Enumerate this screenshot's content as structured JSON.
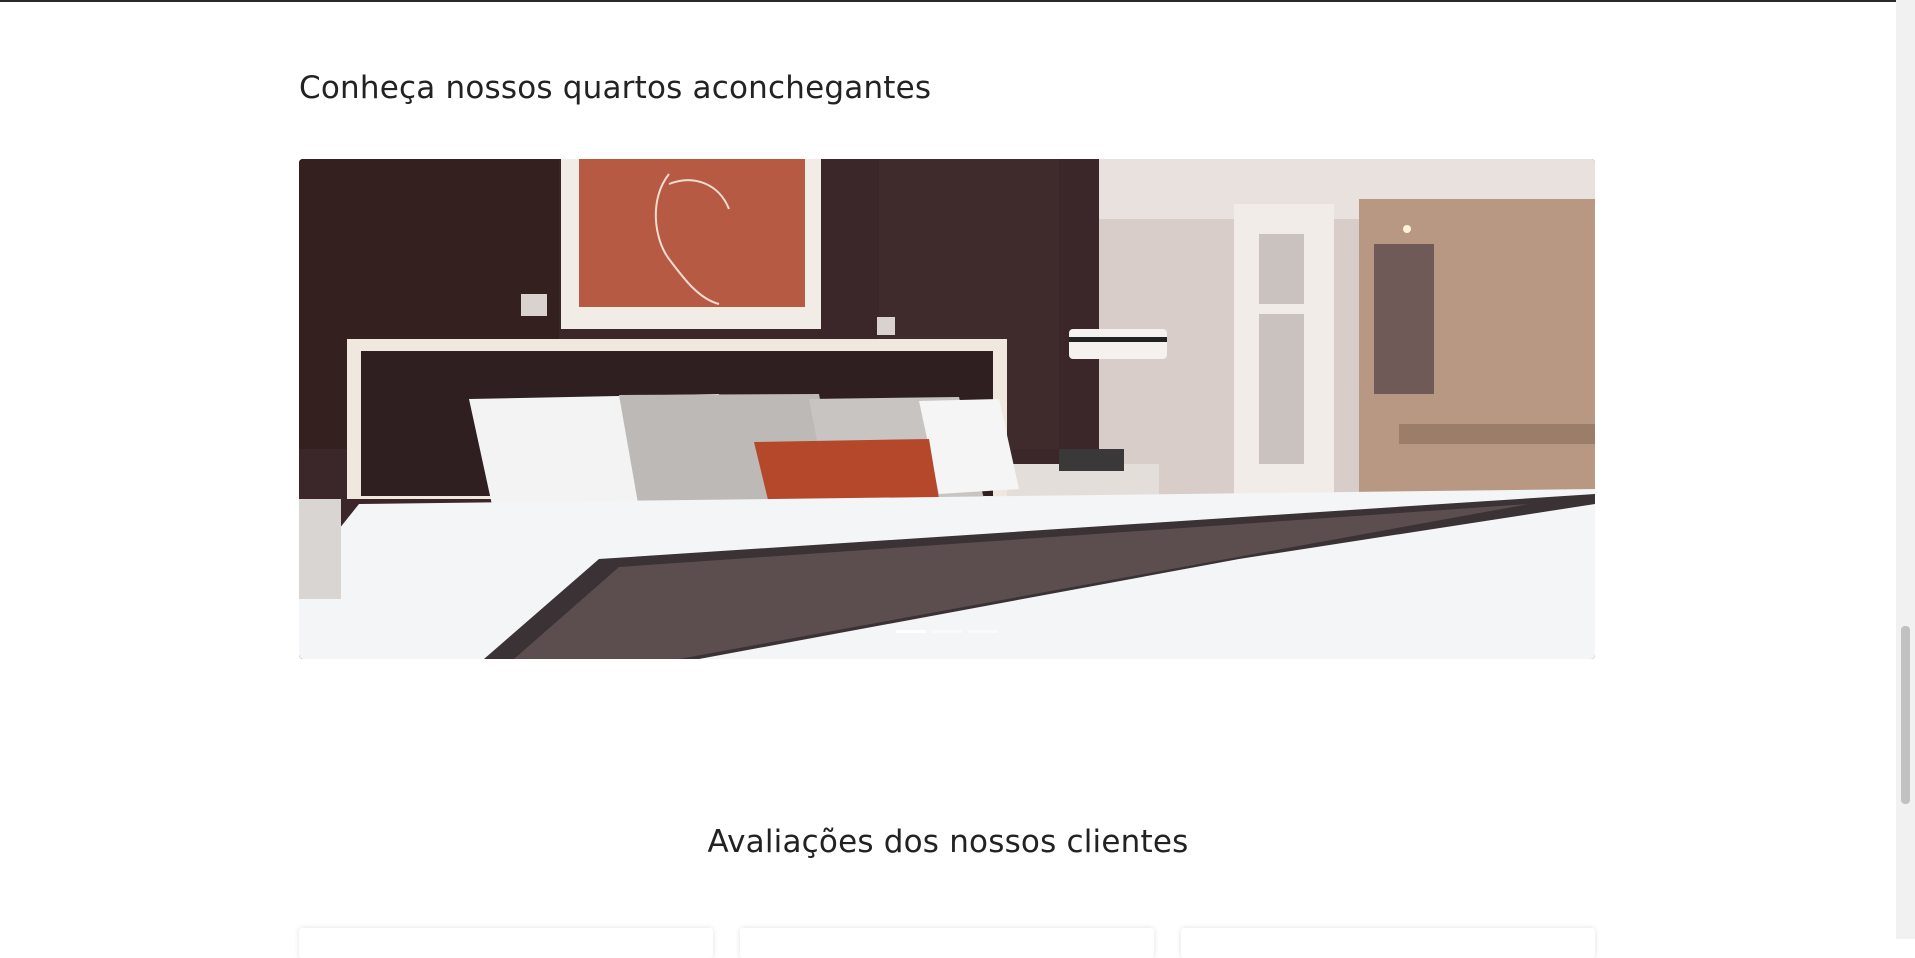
{
  "rooms_section": {
    "title": "Conheça nossos quartos aconchegantes",
    "carousel": {
      "slide_count": 3,
      "active_index": 0,
      "image_subject": "hotel bedroom with bed and headboard"
    }
  },
  "reviews_section": {
    "title": "Avaliações dos nossos clientes",
    "card_count": 3
  },
  "colors": {
    "heading": "#222222",
    "background": "#ffffff",
    "wall_dark": "#3a2528",
    "accent_orange": "#b5472a"
  }
}
